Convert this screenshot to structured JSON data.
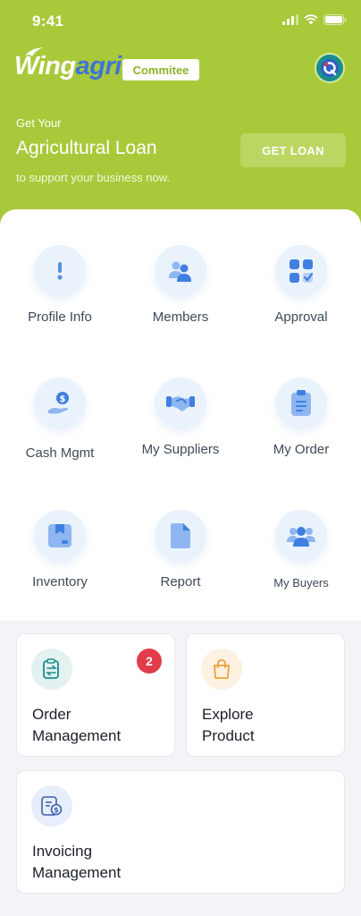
{
  "status_bar": {
    "time": "9:41"
  },
  "brand": {
    "logo_part1": "Wing",
    "logo_part2": "agri",
    "role_badge": "Commitee",
    "brand_color": "#a8c93a",
    "logo_accent": "#3f73d6"
  },
  "loan_banner": {
    "eyebrow": "Get Your",
    "title": "Agricultural Loan",
    "subtitle": "to support your business now.",
    "button_label": "GET LOAN"
  },
  "menu": {
    "items": [
      {
        "label": "Profile Info",
        "icon": "alert-icon"
      },
      {
        "label": "Members",
        "icon": "users-icon"
      },
      {
        "label": "Approval",
        "icon": "grid-check-icon"
      },
      {
        "label": "Cash Mgmt",
        "icon": "hand-coin-icon"
      },
      {
        "label": "My Suppliers",
        "icon": "handshake-icon"
      },
      {
        "label": "My Order",
        "icon": "clipboard-icon"
      },
      {
        "label": "Inventory",
        "icon": "box-icon"
      },
      {
        "label": "Report",
        "icon": "document-icon"
      },
      {
        "label": "My Buyers",
        "icon": "group-icon"
      }
    ]
  },
  "tiles": {
    "order_management": {
      "line1": "Order",
      "line2": "Management",
      "badge_count": "2",
      "icon": "order-transfer-icon"
    },
    "explore_product": {
      "line1": "Explore",
      "line2": "Product",
      "icon": "shopping-bag-icon"
    },
    "invoicing_management": {
      "line1": "Invoicing",
      "line2": "Management",
      "icon": "invoice-icon"
    }
  }
}
